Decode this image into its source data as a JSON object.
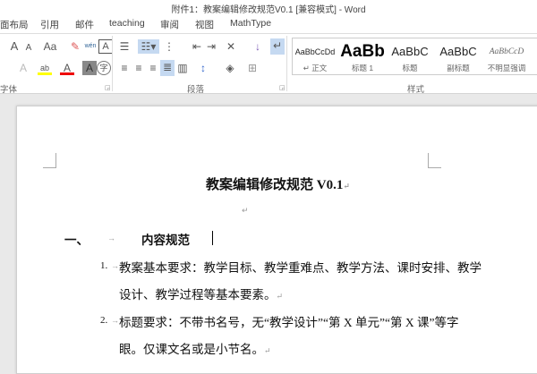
{
  "window": {
    "title": "附件1：教案编辑修改规范V0.1 [兼容模式] - Word"
  },
  "tabs": [
    "面布局",
    "引用",
    "邮件",
    "teaching",
    "审阅",
    "视图",
    "MathType"
  ],
  "groups": {
    "font": "字体",
    "paragraph": "段落",
    "styles": "样式"
  },
  "styles": [
    {
      "sample": "AaBbCcDd",
      "name": "正文"
    },
    {
      "sample": "AaBb",
      "name": "标题 1"
    },
    {
      "sample": "AaBbC",
      "name": "标题"
    },
    {
      "sample": "AaBbC",
      "name": "副标题"
    },
    {
      "sample": "AaBbCcD",
      "name": "不明显强调"
    }
  ],
  "ribbon": {
    "font_size_up": "A",
    "font_size_down": "A",
    "change_case": "Aa",
    "phonetic": "wén",
    "char_border": "A",
    "font_color": "A",
    "char_shading": "A",
    "enclose": "字",
    "text_effect": "A"
  },
  "document": {
    "title": "教案编辑修改规范 V0.1",
    "heading_num": "一、",
    "heading": "内容规范",
    "items": [
      {
        "num": "1.",
        "lines": [
          "教案基本要求：教学目标、教学重难点、教学方法、课时安排、教学",
          "设计、教学过程等基本要素。"
        ]
      },
      {
        "num": "2.",
        "lines": [
          "标题要求：不带书名号，无“教学设计”“第 X 单元”“第 X 课”等字",
          "眼。仅课文名或是小节名。"
        ]
      }
    ]
  }
}
